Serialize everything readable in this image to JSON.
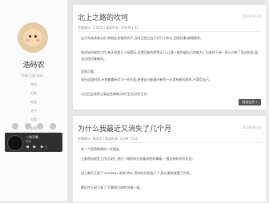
{
  "sidebar": {
    "site_name": "浩码农",
    "site_desc": "前端,后端,移动...",
    "nav": [
      "首页",
      "归档",
      "标签",
      "关于",
      "分类",
      "友链"
    ],
    "player": {
      "title": "一首不晚",
      "artist": "陈粒",
      "controls": "◀ ▶ ▶|"
    }
  },
  "posts": [
    {
      "title": "北上之路的坎坷",
      "date": "2019-02-24",
      "meta": "字数统计: 2.5k字 | 阅读时长: 10分钟 | 41",
      "paragraphs": [
        "这几年陆续来北京,和朋友合租的房子,当时已经过去了好几个年头,回首往事,感慨颇多。",
        "刚开始时候找工作,每天投递几十份简历,但是回复的寥寥无几,让我一度怀疑自己的能力。后来终于有一家公司给了面试机会,面试过程还算顺利。",
        "回到正题。",
        "现在这段时间,计划着重新学习一些东西,希望自己能够在新的一年里有新的收获,不辜负自己。",
        "以后还会继续记录这些事情,好好生活,好好工作。"
      ],
      "readmore": "阅读全文 »"
    },
    {
      "title": "为什么我最近又消失了几个月",
      "date": "2018-06-04",
      "meta": "字数统计: 960字 | 阅读时长: 3分钟 | 312",
      "paragraphs": [
        "其一个很遗憾想的一些朋友。",
        "主要原因就是工作比较忙,然后一段时间在准备其他的事情,一直没有时间写东西。",
        "加上最近又换了 windows 系统,Mac 用的时间也变少了,所以更新就慢了许多。",
        "最近终于闲下来了,打算把之前的坑填一填。"
      ]
    }
  ]
}
